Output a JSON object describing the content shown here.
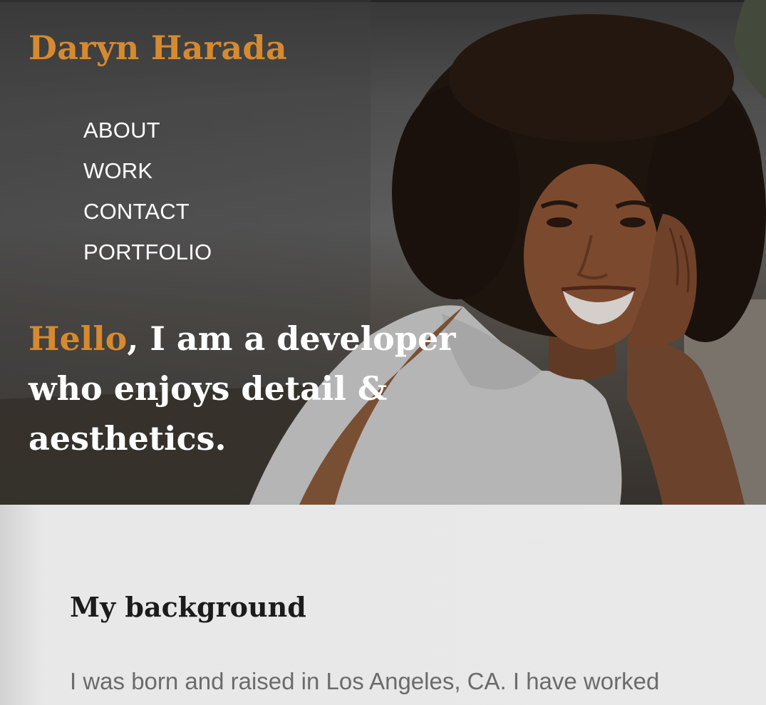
{
  "site": {
    "name": "Daryn Harada"
  },
  "nav": {
    "items": [
      {
        "label": "ABOUT"
      },
      {
        "label": "WORK"
      },
      {
        "label": "CONTACT"
      },
      {
        "label": "PORTFOLIO"
      }
    ]
  },
  "hero": {
    "headline_accent": "Hello",
    "headline_rest": ", I am a developer who enjoys detail & aesthetics."
  },
  "background": {
    "title": "My background",
    "text": "I was born and raised in Los Angeles, CA. I have worked"
  },
  "colors": {
    "accent": "#d68a2f",
    "hero_overlay": "#5a5a5a",
    "section_bg": "#e8e8e8",
    "body_text": "#6b6b6b",
    "heading_text": "#1b1b1b"
  }
}
